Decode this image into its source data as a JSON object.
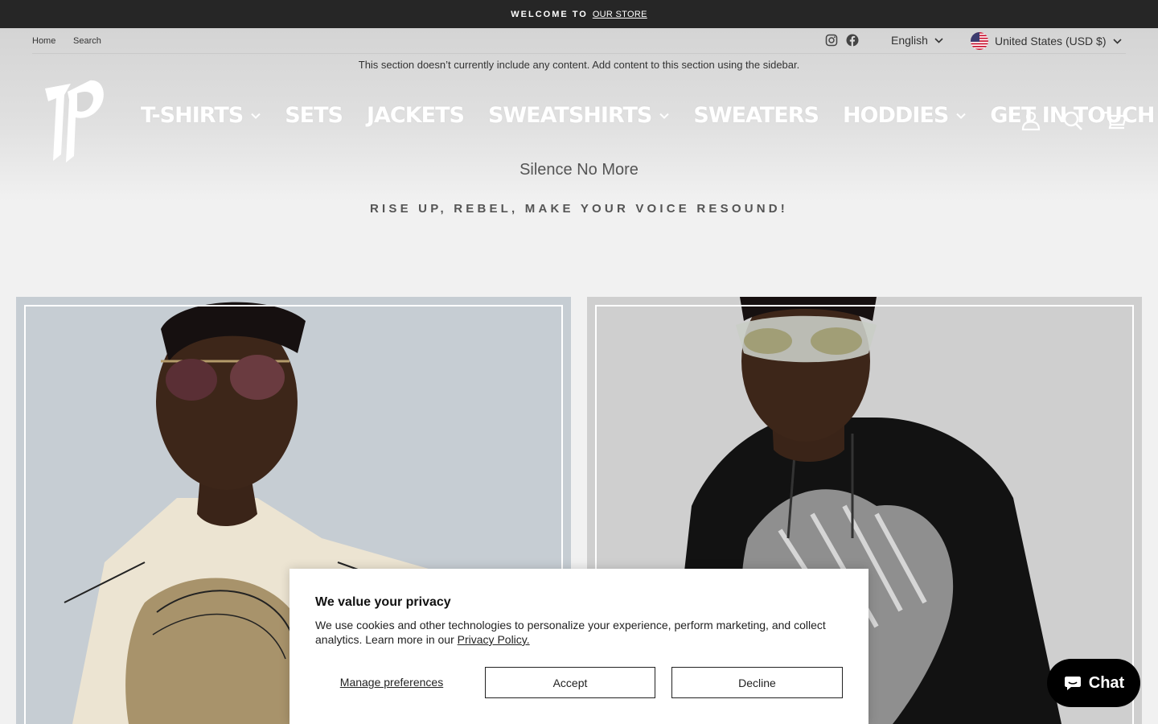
{
  "announcement": {
    "text": "WELCOME TO",
    "link": "OUR STORE"
  },
  "utility": {
    "links": [
      "Home",
      "Search"
    ],
    "social_icons": [
      "instagram-icon",
      "facebook-icon"
    ],
    "language": "English",
    "currency": "United States (USD $)",
    "flag_icon": "us-flag-icon"
  },
  "notice": "This section doesn’t currently include any content. Add content to this section using the sidebar.",
  "brand": {
    "logo_icon": "brand-monogram-logo"
  },
  "nav": {
    "items": [
      {
        "label": "T-SHIRTS",
        "has_dropdown": true
      },
      {
        "label": "SETS",
        "has_dropdown": false
      },
      {
        "label": "JACKETS",
        "has_dropdown": false
      },
      {
        "label": "SWEATSHIRTS",
        "has_dropdown": true
      },
      {
        "label": "SWEATERS",
        "has_dropdown": false
      },
      {
        "label": "HODDIES",
        "has_dropdown": true
      },
      {
        "label": "GET IN TOUCH",
        "has_dropdown": false
      }
    ],
    "icons": [
      "account-icon",
      "search-icon",
      "cart-icon"
    ]
  },
  "hero": {
    "title": "Silence No More",
    "subtitle": "RISE UP, REBEL, MAKE YOUR VOICE RESOUND!"
  },
  "cards": [
    {
      "image": "model-in-graphic-tshirt-photo"
    },
    {
      "image": "model-in-black-hoodie-photo"
    }
  ],
  "cookie": {
    "title": "We value your privacy",
    "body": "We use cookies and other technologies to personalize your experience, perform marketing, and collect analytics. Learn more in our",
    "policy_link": "Privacy Policy.",
    "manage": "Manage preferences",
    "accept": "Accept",
    "decline": "Decline"
  },
  "chat": {
    "label": "Chat"
  },
  "colors": {
    "announcement_bg": "#262626",
    "page_bg": "#f1f1f1",
    "chat_bg": "#000000"
  }
}
